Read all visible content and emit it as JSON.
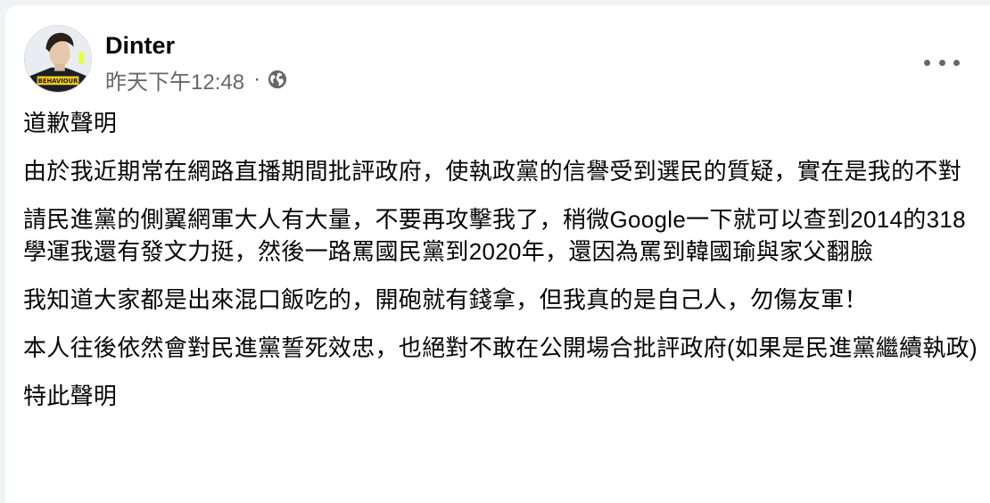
{
  "post": {
    "author": "Dinter",
    "timestamp": "昨天下午12:48",
    "separator": "·",
    "audience_icon": "globe-icon",
    "menu_icon": "more-options-icon",
    "paragraphs": [
      "道歉聲明",
      "由於我近期常在網路直播期間批評政府，使執政黨的信譽受到選民的質疑，實在是我的不對",
      "請民進黨的側翼網軍大人有大量，不要再攻擊我了，稍微Google一下就可以查到2014的318學運我還有發文力挺，然後一路罵國民黨到2020年，還因為罵到韓國瑜與家父翻臉",
      "我知道大家都是出來混口飯吃的，開砲就有錢拿，但我真的是自己人，勿傷友軍！",
      "本人往後依然會對民進黨誓死效忠，也絕對不敢在公開場合批評政府(如果是民進黨繼續執政)",
      "特此聲明"
    ]
  }
}
